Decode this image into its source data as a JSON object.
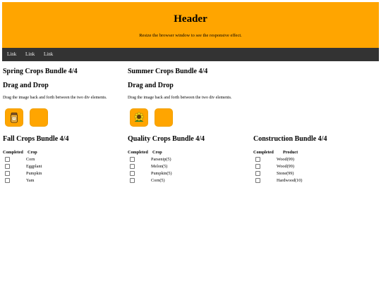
{
  "header": {
    "title": "Header",
    "subtitle": "Resize the browser window to see the responsive effect."
  },
  "nav": {
    "links": [
      "Link",
      "Link",
      "Link"
    ]
  },
  "spring": {
    "title": "Spring Crops Bundle 4/4",
    "dd_title": "Drag and Drop",
    "dd_text": "Drag the image back and forth between the two div elements.",
    "icon": "honey-jar-icon"
  },
  "summer": {
    "title": "Summer Crops Bundle 4/4",
    "dd_title": "Drag and Drop",
    "dd_text": "Drag the image back and forth between the two div elements.",
    "icon": "sunflower-icon"
  },
  "fall": {
    "title": "Fall Crops Bundle 4/4",
    "headers": [
      "Completed",
      "Crop"
    ],
    "rows": [
      "Corn",
      "Eggplant",
      "Pumpkin",
      "Yam"
    ]
  },
  "quality": {
    "title": "Quality Crops Bundle 4/4",
    "headers": [
      "Completed",
      "Crop"
    ],
    "rows": [
      "Parsenip(5)",
      "Melon(5)",
      "Pumpkin(5)",
      "Corn(5)"
    ]
  },
  "construction": {
    "title": "Construction Bundle 4/4",
    "headers": [
      "Completed",
      "Product"
    ],
    "rows": [
      "Wood(99)",
      "Wood(99)",
      "Stone(99)",
      "Hardwood(10)"
    ]
  },
  "colors": {
    "accent": "#ffa500",
    "nav": "#333333",
    "nav_text": "#f2f2f2"
  }
}
